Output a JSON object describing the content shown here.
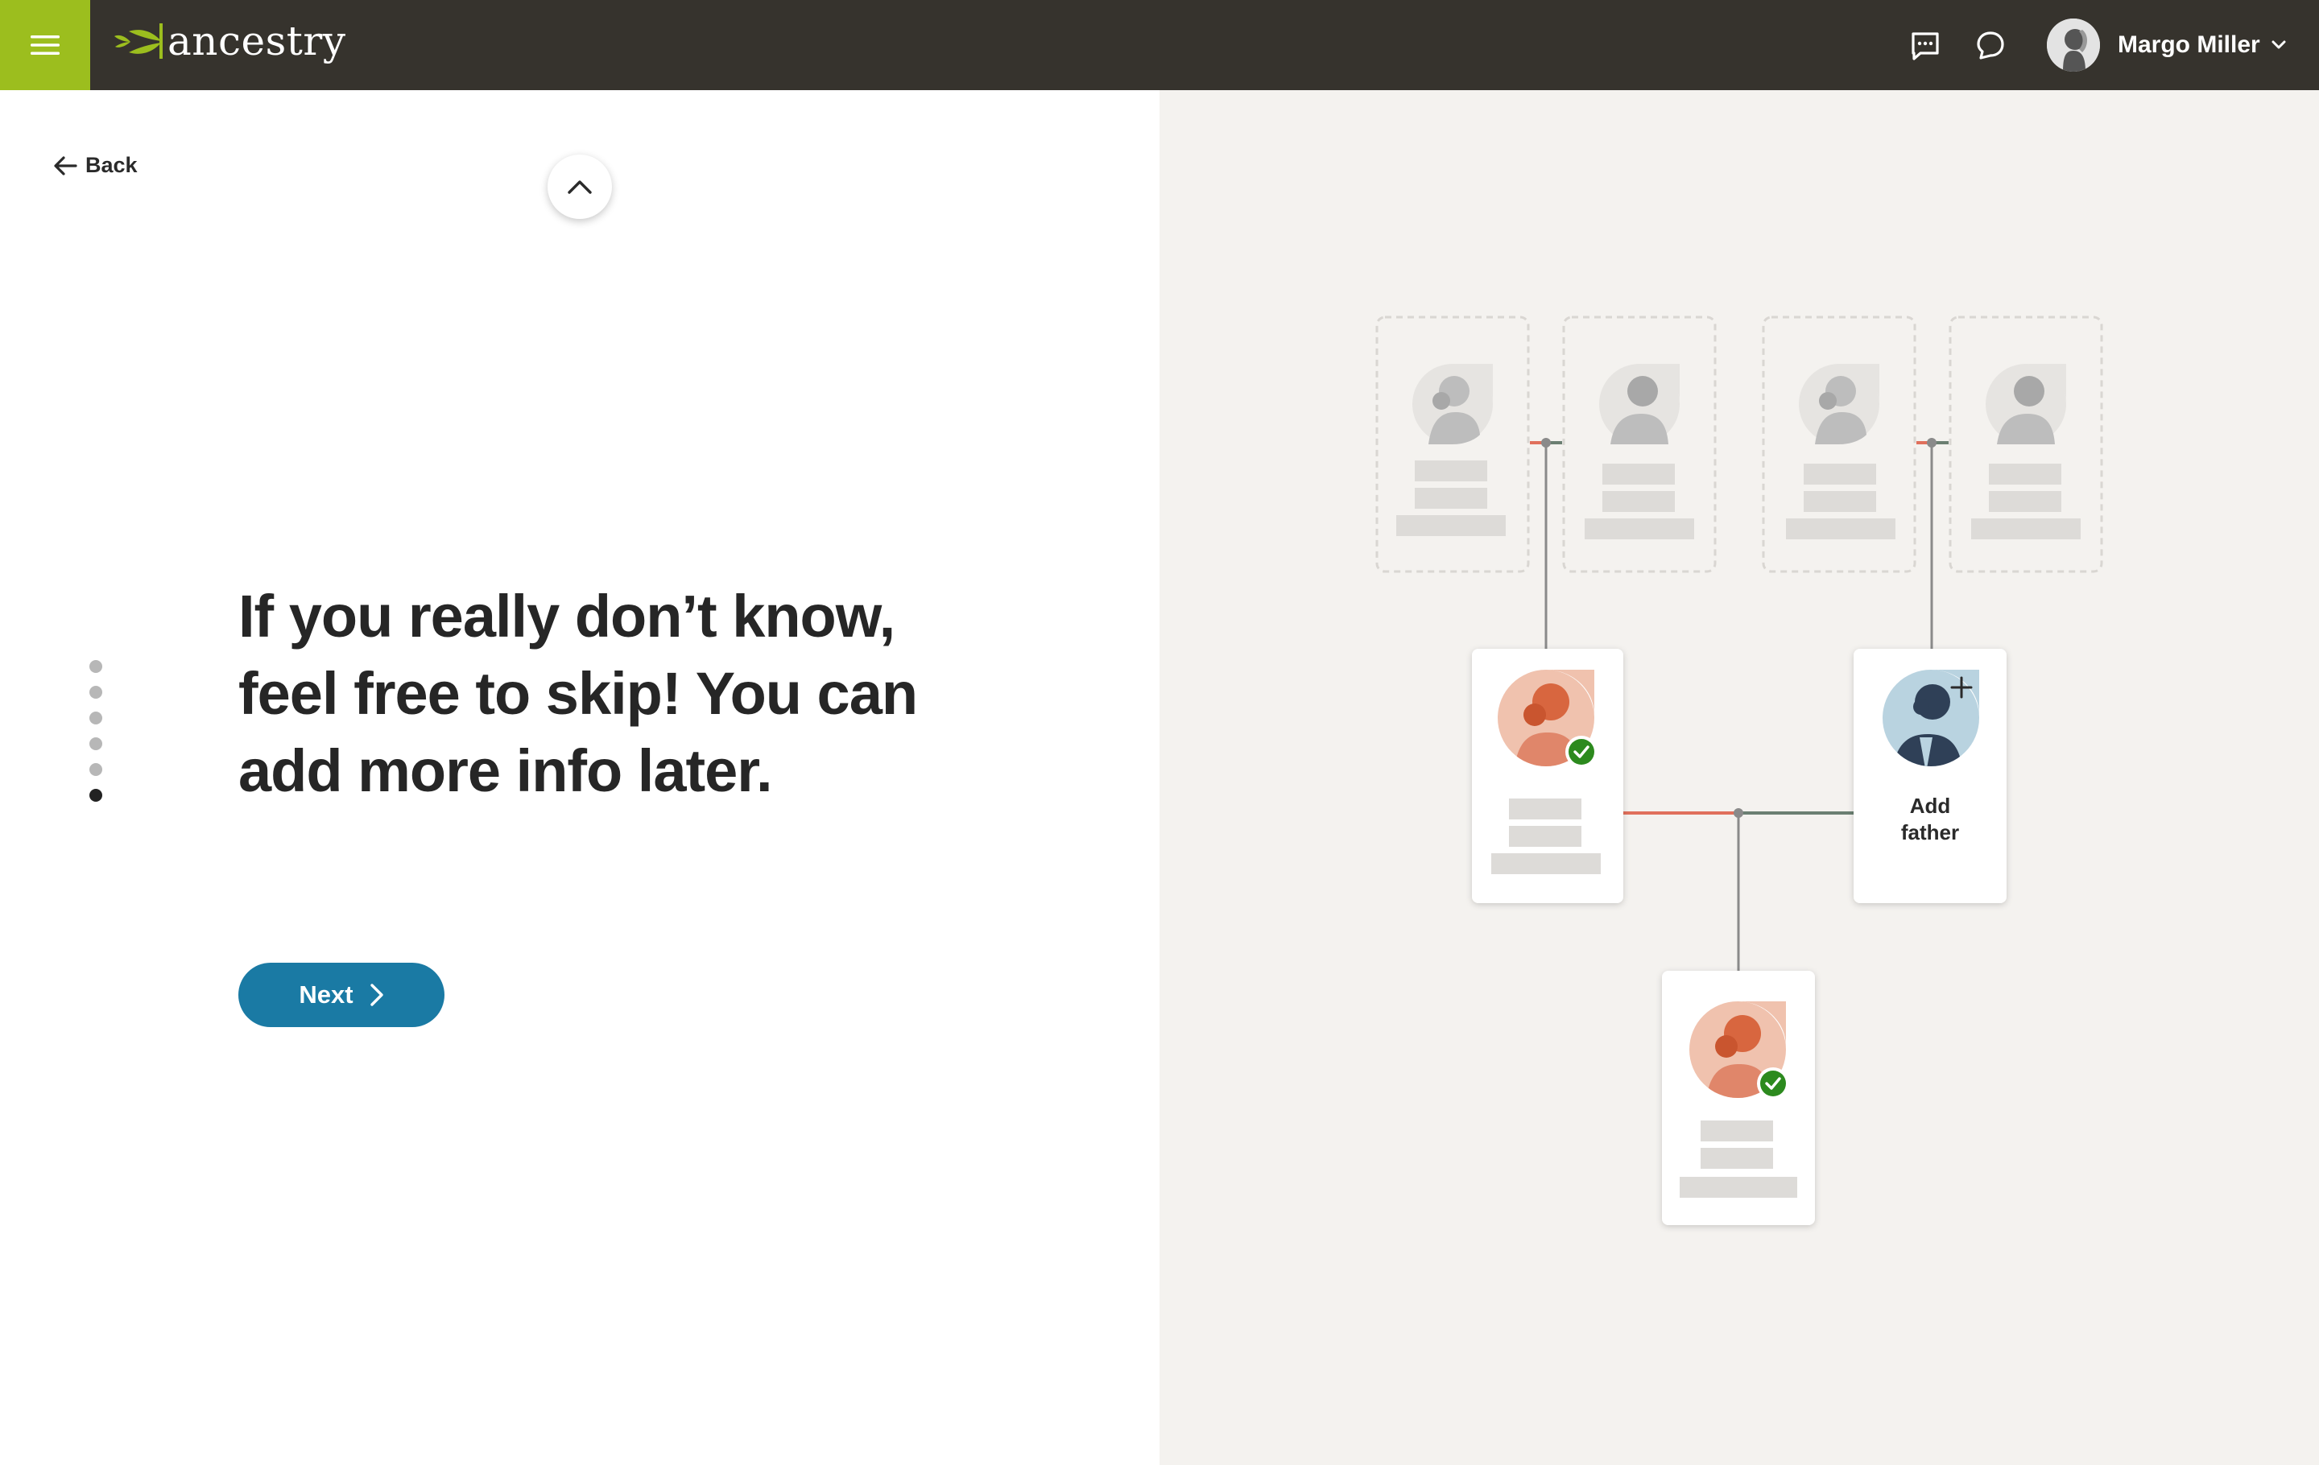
{
  "header": {
    "logo_text": "ancestry",
    "user_name": "Margo Miller",
    "brand_color": "#9cbe1e",
    "bar_color": "#36332d",
    "icons": [
      "menu-icon",
      "messages-icon",
      "chat-icon",
      "chevron-down-icon"
    ]
  },
  "nav": {
    "back_label": "Back"
  },
  "content": {
    "headline_line1": "If you really don’t know,",
    "headline_line2": "feel free to skip! You can",
    "headline_line3": "add more info later.",
    "next_label": "Next",
    "steps_total": 6,
    "steps_current": 6
  },
  "tree": {
    "add_father_line1": "Add",
    "add_father_line2": "father",
    "accent_female": "#e38f75",
    "accent_male": "#b9d3e0",
    "check_color": "#2c8a1e",
    "line_female": "#e0705c",
    "line_male": "#6b7f72"
  }
}
